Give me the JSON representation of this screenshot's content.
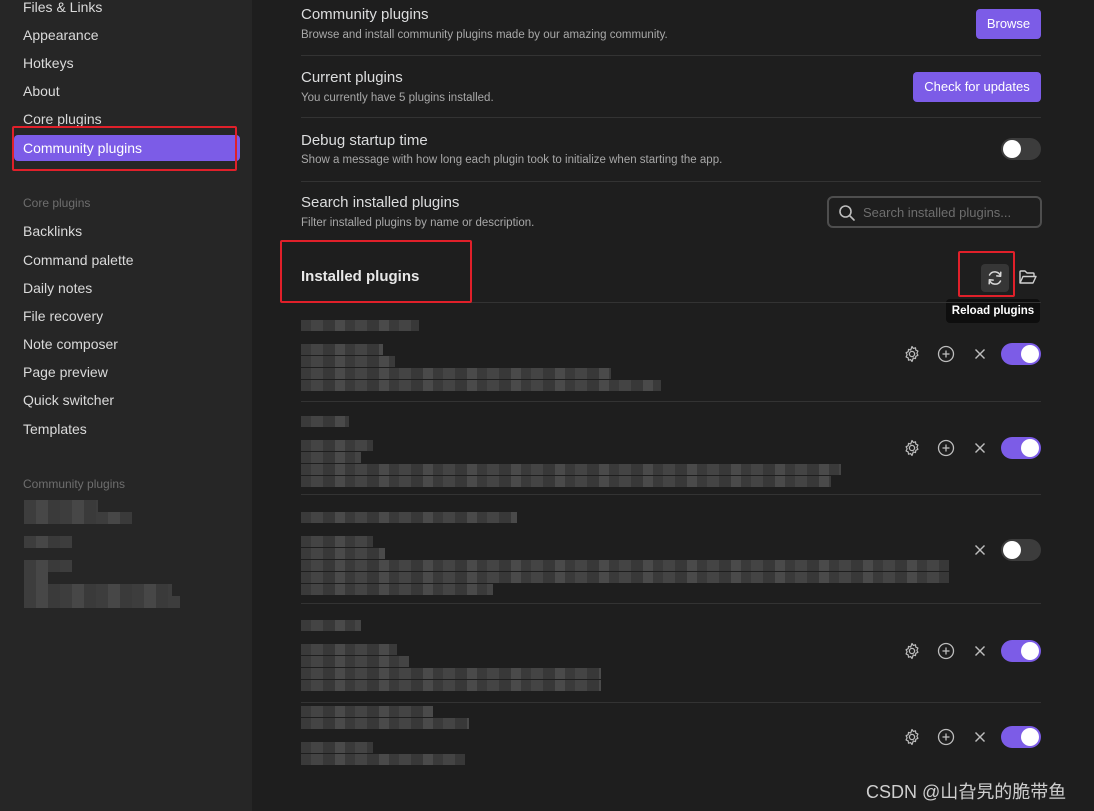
{
  "sidebar": {
    "top_items": [
      "Files & Links",
      "Appearance",
      "Hotkeys",
      "About",
      "Core plugins"
    ],
    "active_item": "Community plugins",
    "core_heading": "Core plugins",
    "core_items": [
      "Backlinks",
      "Command palette",
      "Daily notes",
      "File recovery",
      "Note composer",
      "Page preview",
      "Quick switcher",
      "Templates"
    ],
    "community_heading": "Community plugins"
  },
  "settings": {
    "community": {
      "name": "Community plugins",
      "desc": "Browse and install community plugins made by our amazing community.",
      "button": "Browse"
    },
    "current": {
      "name": "Current plugins",
      "desc": "You currently have 5 plugins installed.",
      "button": "Check for updates"
    },
    "debug": {
      "name": "Debug startup time",
      "desc": "Show a message with how long each plugin took to initialize when starting the app.",
      "enabled": false
    },
    "search": {
      "name": "Search installed plugins",
      "desc": "Filter installed plugins by name or description.",
      "placeholder": "Search installed plugins..."
    }
  },
  "installed": {
    "title": "Installed plugins",
    "reload_tooltip": "Reload plugins",
    "plugins": [
      {
        "enabled": true,
        "has_settings": true,
        "has_hotkeys": true
      },
      {
        "enabled": true,
        "has_settings": true,
        "has_hotkeys": true
      },
      {
        "enabled": false,
        "has_settings": false,
        "has_hotkeys": false
      },
      {
        "enabled": true,
        "has_settings": true,
        "has_hotkeys": true
      },
      {
        "enabled": true,
        "has_settings": true,
        "has_hotkeys": true
      }
    ]
  },
  "watermark": "CSDN @山旮旯的脆带鱼",
  "colors": {
    "accent": "#7c5ce7",
    "highlight_box": "#e0202a"
  }
}
